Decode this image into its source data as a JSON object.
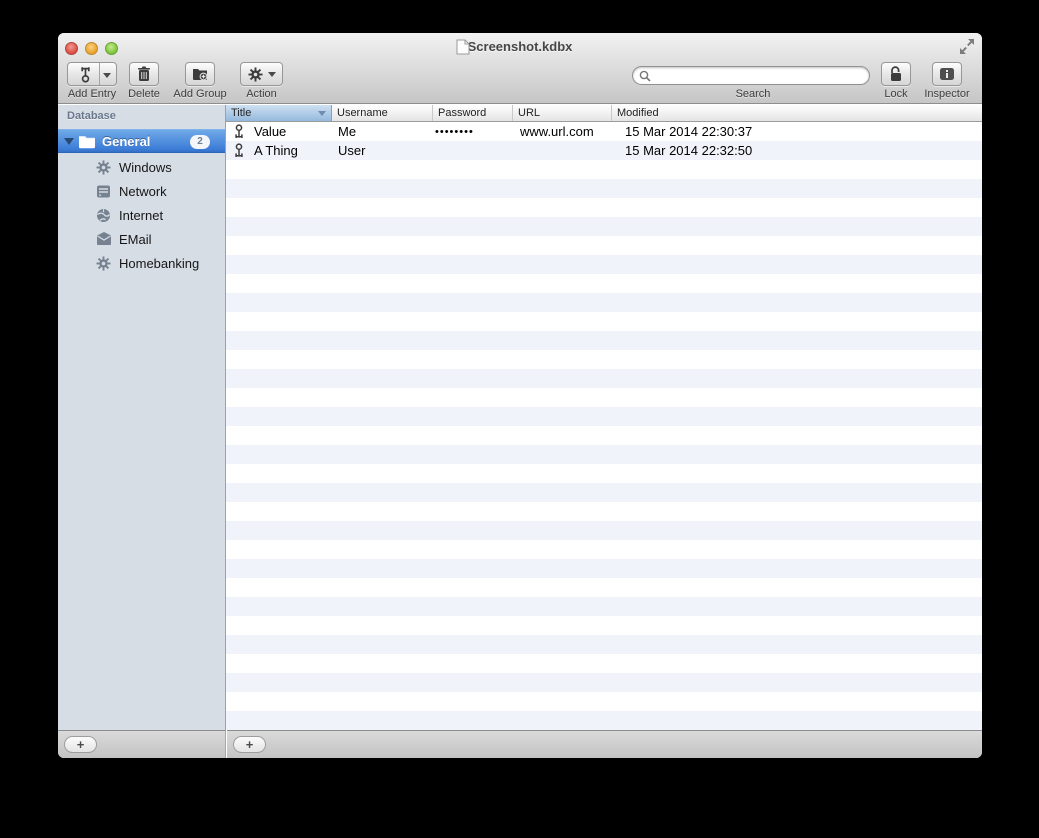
{
  "window": {
    "title": "Screenshot.kdbx"
  },
  "toolbar": {
    "add_entry_label": "Add Entry",
    "delete_label": "Delete",
    "add_group_label": "Add Group",
    "action_label": "Action",
    "lock_label": "Lock",
    "inspector_label": "Inspector",
    "search": {
      "label": "Search",
      "value": "",
      "placeholder": ""
    }
  },
  "sidebar": {
    "header": "Database",
    "root_group": {
      "label": "General",
      "badge": "2",
      "expanded": true
    },
    "items": [
      {
        "label": "Windows",
        "icon": "gear-icon"
      },
      {
        "label": "Network",
        "icon": "server-icon"
      },
      {
        "label": "Internet",
        "icon": "globe-icon"
      },
      {
        "label": "EMail",
        "icon": "envelope-icon"
      },
      {
        "label": "Homebanking",
        "icon": "gear-icon"
      }
    ],
    "add_group_button": "+"
  },
  "table": {
    "columns": [
      {
        "label": "Title",
        "sorted": true
      },
      {
        "label": "Username"
      },
      {
        "label": "Password"
      },
      {
        "label": "URL"
      },
      {
        "label": "Modified"
      }
    ],
    "rows": [
      {
        "icon": "key-icon",
        "title": "Value",
        "username": "Me",
        "password": "••••••••",
        "url": "www.url.com",
        "modified": "15 Mar 2014 22:30:37"
      },
      {
        "icon": "key-icon",
        "title": "A Thing",
        "username": "User",
        "password": "",
        "url": "",
        "modified": "15 Mar 2014 22:32:50"
      }
    ],
    "add_entry_button": "+"
  },
  "colors": {
    "selection_blue_top": "#6fa9e7",
    "selection_blue_bottom": "#336fc4",
    "sorted_header_top": "#cfe0f1",
    "sorted_header_bottom": "#94b9dd",
    "row_stripe": "#f0f4fa",
    "sidebar_bg": "#d6dde5",
    "window_chrome_top": "#f2f2f2",
    "window_chrome_bottom": "#c6c6c6"
  }
}
